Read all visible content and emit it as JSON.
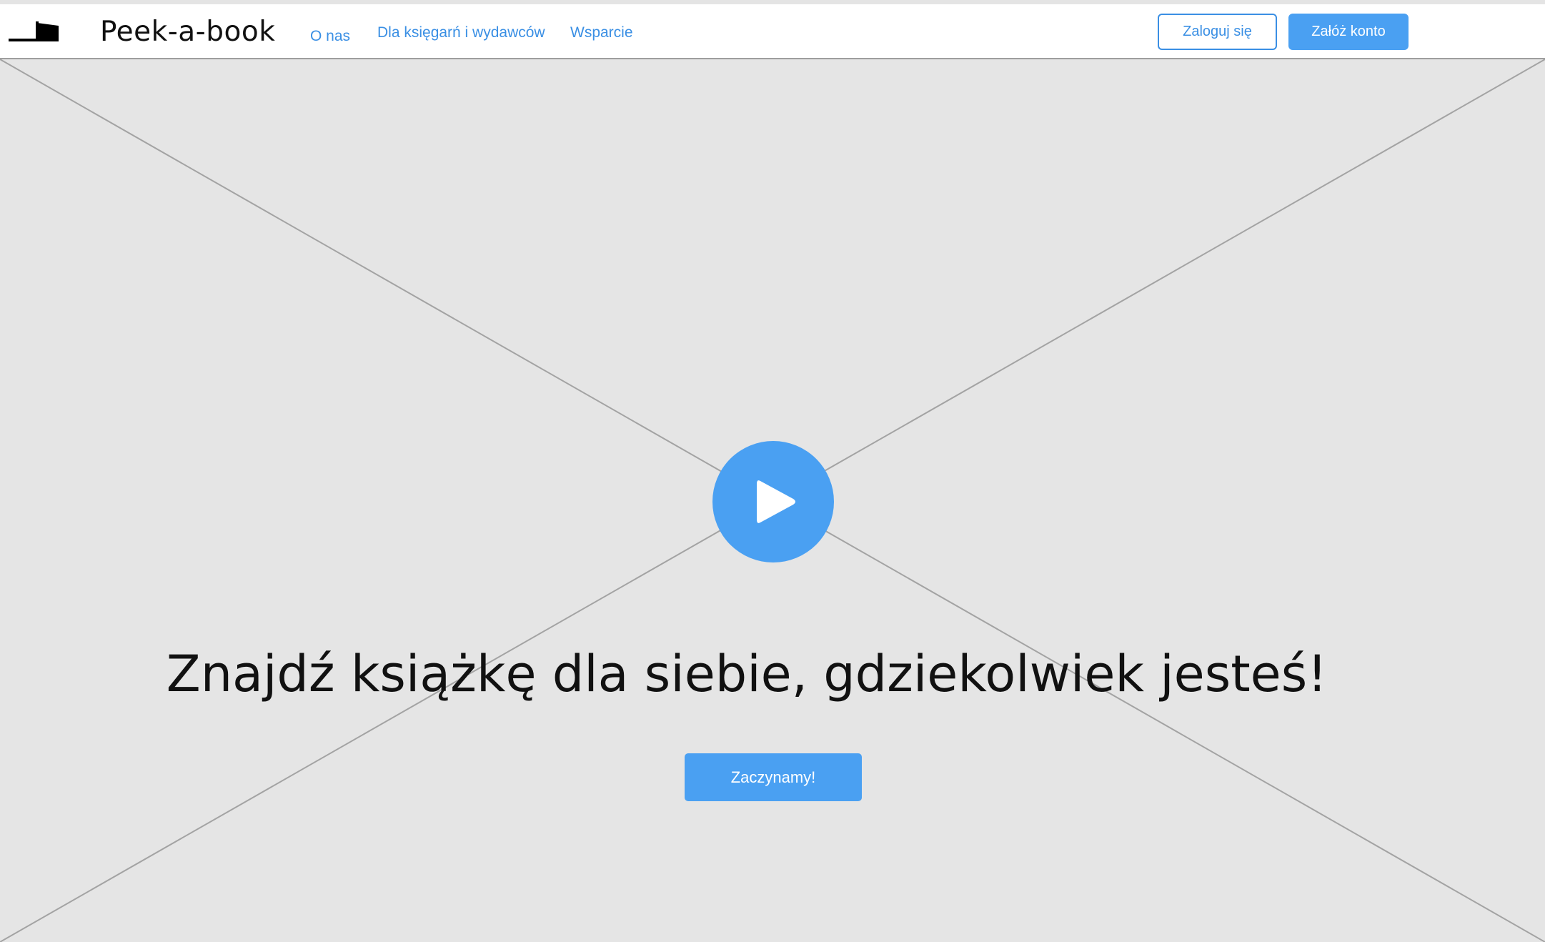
{
  "header": {
    "brand": "Peek-a-book",
    "nav": {
      "about": "O nas",
      "for_stores": "Dla księgarń i wydawców",
      "support": "Wsparcie"
    },
    "login_label": "Zaloguj się",
    "register_label": "Załóż konto"
  },
  "hero": {
    "headline": "Znajdź książkę dla siebie, gdziekolwiek jesteś!",
    "cta_label": "Zaczynamy!",
    "media": "video-placeholder",
    "play_icon": "play-icon"
  },
  "colors": {
    "accent": "#4aa0f2",
    "link": "#3a8fe4",
    "placeholder_bg": "#e5e5e5",
    "text": "#111111"
  },
  "icons": {
    "logo": "book-peek-logo-icon",
    "play": "play-icon"
  }
}
